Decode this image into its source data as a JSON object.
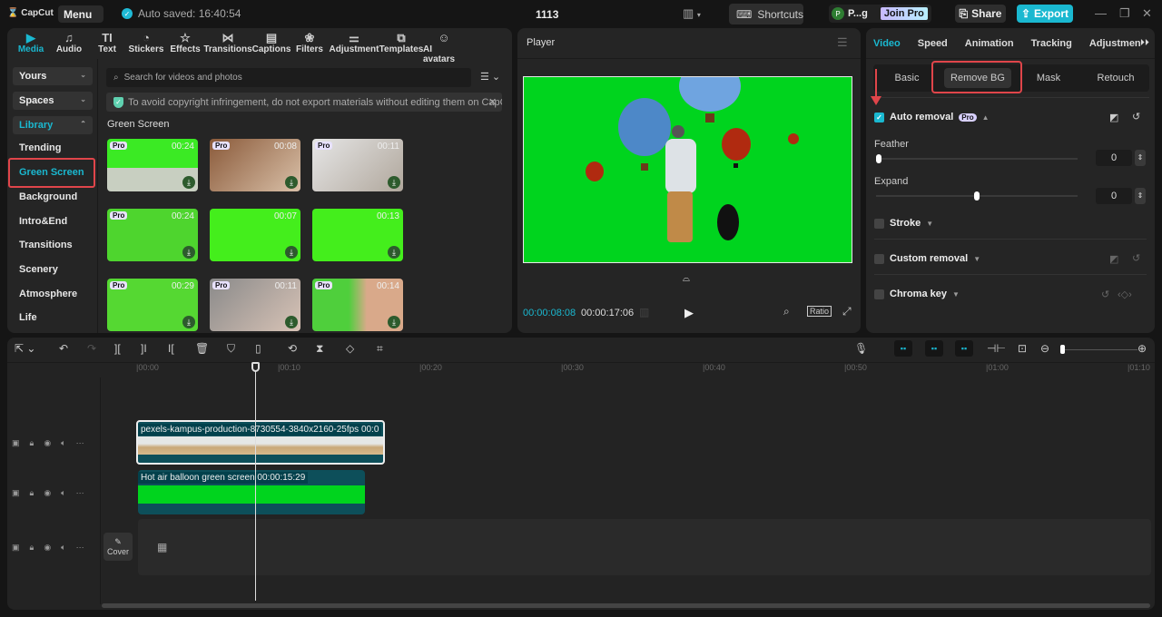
{
  "app": {
    "name": "CapCut",
    "menu_label": "Menu",
    "autosave_text": "Auto saved: 16:40:54",
    "project_title": "1113"
  },
  "titlebar": {
    "shortcuts_label": "Shortcuts",
    "user_initial": "P",
    "user_name": "P...g",
    "join_pro_label": "Join Pro",
    "share_label": "Share",
    "export_label": "Export",
    "accent": "#1ab8d0"
  },
  "media_tabs": [
    {
      "label": "Media",
      "icon": "media-icon",
      "active": true
    },
    {
      "label": "Audio",
      "icon": "audio-icon"
    },
    {
      "label": "Text",
      "icon": "text-icon"
    },
    {
      "label": "Stickers",
      "icon": "stickers-icon"
    },
    {
      "label": "Effects",
      "icon": "effects-icon"
    },
    {
      "label": "Transitions",
      "icon": "transitions-icon"
    },
    {
      "label": "Captions",
      "icon": "captions-icon"
    },
    {
      "label": "Filters",
      "icon": "filters-icon"
    },
    {
      "label": "Adjustment",
      "icon": "adjustment-icon"
    },
    {
      "label": "Templates",
      "icon": "templates-icon"
    },
    {
      "label": "AI avatars",
      "icon": "ai-avatars-icon"
    }
  ],
  "media_sidebar": {
    "dropdowns": [
      "Yours",
      "Spaces",
      "Library"
    ],
    "items": [
      "Trending",
      "Green Screen",
      "Background",
      "Intro&End",
      "Transitions",
      "Scenery",
      "Atmosphere",
      "Life"
    ],
    "selected": "Green Screen"
  },
  "search": {
    "placeholder": "Search for videos and photos"
  },
  "notice": {
    "text": "To avoid copyright infringement, do not export materials without editing them on CapC"
  },
  "library": {
    "section_title": "Green Screen",
    "items": [
      {
        "pro": true,
        "duration": "00:24",
        "subject": "money"
      },
      {
        "pro": true,
        "duration": "00:08",
        "subject": "phone-hands"
      },
      {
        "pro": true,
        "duration": "00:11",
        "subject": "phone-landscape"
      },
      {
        "pro": true,
        "duration": "00:24",
        "subject": "woman-standing"
      },
      {
        "pro": false,
        "duration": "00:07",
        "subject": "plain-green"
      },
      {
        "pro": false,
        "duration": "00:13",
        "subject": "green-ui"
      },
      {
        "pro": true,
        "duration": "00:29",
        "subject": "woman-presenter"
      },
      {
        "pro": true,
        "duration": "00:11",
        "subject": "woman-phone"
      },
      {
        "pro": true,
        "duration": "00:14",
        "subject": "man-thinking"
      }
    ],
    "pro_label": "Pro"
  },
  "player": {
    "title": "Player",
    "current_time": "00:00:08:08",
    "total_time": "00:00:17:06",
    "ratio_label": "Ratio",
    "canvas_color": "#00d41e"
  },
  "properties": {
    "tabs": [
      "Video",
      "Speed",
      "Animation",
      "Tracking",
      "Adjustment"
    ],
    "active_tab": "Video",
    "subtabs": [
      "Basic",
      "Remove BG",
      "Mask",
      "Retouch"
    ],
    "active_subtab": "Remove BG",
    "auto_removal": {
      "label": "Auto removal",
      "checked": true,
      "pro_label": "Pro"
    },
    "feather": {
      "label": "Feather",
      "value": "0",
      "slider_fraction": 0
    },
    "expand": {
      "label": "Expand",
      "value": "0",
      "slider_fraction": 0.5
    },
    "stroke": {
      "label": "Stroke",
      "checked": false
    },
    "custom_removal": {
      "label": "Custom removal",
      "checked": false
    },
    "chroma_key": {
      "label": "Chroma key",
      "checked": false
    }
  },
  "timeline": {
    "ruler_labels": [
      "00:00",
      "00:10",
      "00:20",
      "00:30",
      "00:40",
      "00:50",
      "01:00",
      "01:10"
    ],
    "playhead_time": "00:00:08:08",
    "clips": [
      {
        "name": "pexels-kampus-production-8730554-3840x2160-25fps",
        "duration_text": "00:0",
        "track": 1,
        "selected": true
      },
      {
        "name": "Hot air balloon green screen",
        "duration_text": "00:00:15:29",
        "track": 2
      }
    ],
    "cover_label": "Cover",
    "zoom_fraction": 0
  }
}
